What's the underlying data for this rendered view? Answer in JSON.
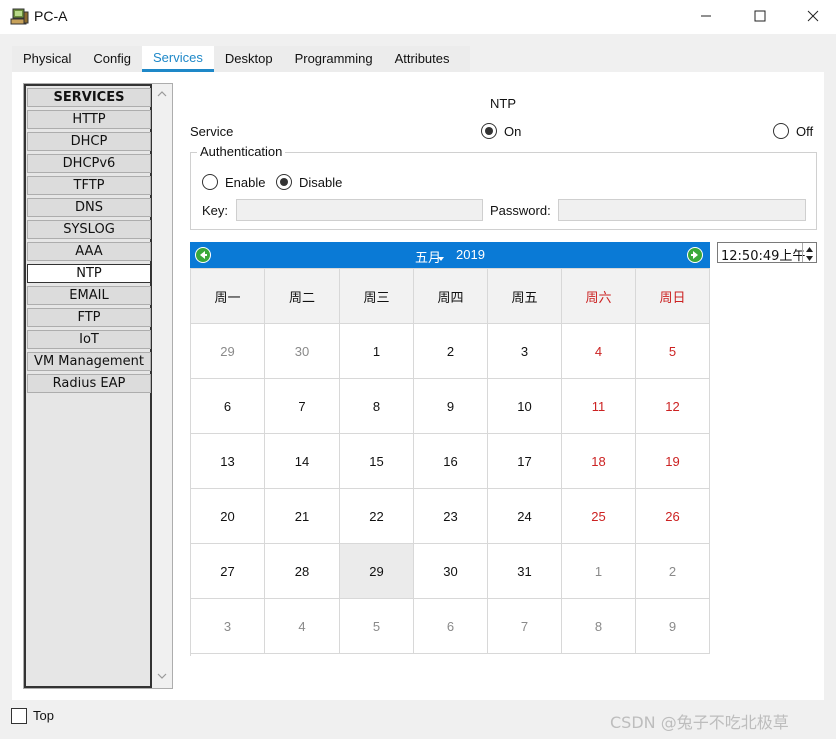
{
  "window": {
    "title": "PC-A",
    "icon": "pc-icon",
    "controls": [
      "minimize-icon",
      "maximize-icon",
      "close-icon"
    ]
  },
  "tabs": [
    {
      "label": "Physical",
      "active": false
    },
    {
      "label": "Config",
      "active": false
    },
    {
      "label": "Services",
      "active": true
    },
    {
      "label": "Desktop",
      "active": false
    },
    {
      "label": "Programming",
      "active": false
    },
    {
      "label": "Attributes",
      "active": false
    }
  ],
  "services": {
    "header": "SERVICES",
    "items": [
      "HTTP",
      "DHCP",
      "DHCPv6",
      "TFTP",
      "DNS",
      "SYSLOG",
      "AAA",
      "NTP",
      "EMAIL",
      "FTP",
      "IoT",
      "VM Management",
      "Radius EAP"
    ],
    "selected": "NTP"
  },
  "ntp": {
    "title": "NTP",
    "service_label": "Service",
    "on_label": "On",
    "off_label": "Off",
    "service_state": "On",
    "auth": {
      "legend": "Authentication",
      "enable_label": "Enable",
      "disable_label": "Disable",
      "state": "Disable",
      "key_label": "Key:",
      "key_value": "",
      "password_label": "Password:",
      "password_value": ""
    }
  },
  "calendar": {
    "month": "五月",
    "year": "2019",
    "weekdays": [
      "周一",
      "周二",
      "周三",
      "周四",
      "周五",
      "周六",
      "周日"
    ],
    "weeks": [
      [
        "29",
        "30",
        "1",
        "2",
        "3",
        "4",
        "5"
      ],
      [
        "6",
        "7",
        "8",
        "9",
        "10",
        "11",
        "12"
      ],
      [
        "13",
        "14",
        "15",
        "16",
        "17",
        "18",
        "19"
      ],
      [
        "20",
        "21",
        "22",
        "23",
        "24",
        "25",
        "26"
      ],
      [
        "27",
        "28",
        "29",
        "30",
        "31",
        "1",
        "2"
      ],
      [
        "3",
        "4",
        "5",
        "6",
        "7",
        "8",
        "9"
      ]
    ],
    "selected_day": "29",
    "weekend_color": "#cc2222",
    "header_color": "#0a7ad6"
  },
  "time": {
    "value": "12:50:49上午"
  },
  "footer": {
    "top_label": "Top",
    "top_checked": false,
    "watermark": "CSDN @兔子不吃北极草"
  },
  "colors": {
    "accent": "#1e88c8"
  }
}
